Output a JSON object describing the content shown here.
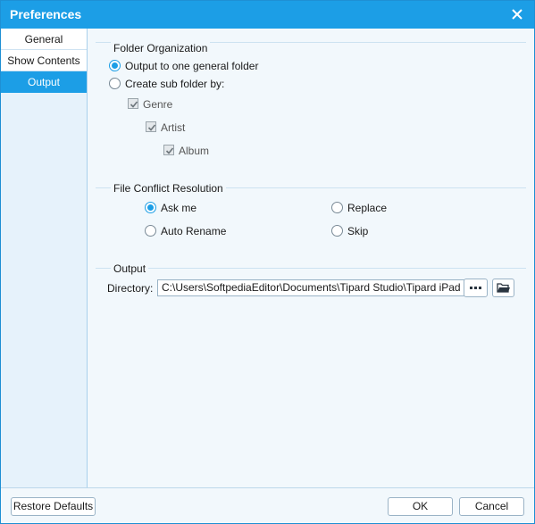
{
  "window": {
    "title": "Preferences"
  },
  "sidebar": {
    "items": [
      {
        "label": "General",
        "active": false
      },
      {
        "label": "Show Contents",
        "active": false
      },
      {
        "label": "Output",
        "active": true
      }
    ]
  },
  "folder_organization": {
    "title": "Folder Organization",
    "option_general": {
      "label": "Output to one general folder",
      "selected": true
    },
    "option_sub": {
      "label": "Create sub folder by:",
      "selected": false
    },
    "genre": {
      "label": "Genre",
      "checked": true
    },
    "artist": {
      "label": "Artist",
      "checked": true
    },
    "album": {
      "label": "Album",
      "checked": true
    }
  },
  "file_conflict": {
    "title": "File Conflict Resolution",
    "ask_me": {
      "label": "Ask me",
      "selected": true
    },
    "replace": {
      "label": "Replace",
      "selected": false
    },
    "auto_rename": {
      "label": "Auto Rename",
      "selected": false
    },
    "skip": {
      "label": "Skip",
      "selected": false
    }
  },
  "output": {
    "title": "Output",
    "directory_label": "Directory:",
    "directory_value": "C:\\Users\\SoftpediaEditor\\Documents\\Tipard Studio\\Tipard iPad to PC Transfer\\",
    "browse_icon": "ellipsis-icon",
    "open_icon": "folder-icon"
  },
  "footer": {
    "restore_label": "Restore Defaults",
    "ok_label": "OK",
    "cancel_label": "Cancel"
  },
  "colors": {
    "accent": "#1c9ee6",
    "background": "#f2f8fc"
  }
}
